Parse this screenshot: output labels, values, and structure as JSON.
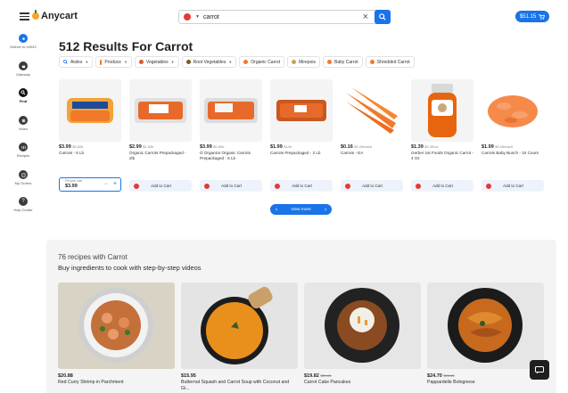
{
  "header": {
    "logo_text": "Anycart",
    "search_value": "carrot",
    "cart_total": "$51.15"
  },
  "sidebar": {
    "items": [
      {
        "label": "Deliver to 94043",
        "icon": "location-icon",
        "active": true
      },
      {
        "label": "Gateway",
        "icon": "store-icon"
      },
      {
        "label": "Find",
        "icon": "search-icon"
      },
      {
        "label": "Video",
        "icon": "video-icon"
      },
      {
        "label": "Recipes",
        "icon": "recipes-icon"
      },
      {
        "label": "My Orders",
        "icon": "orders-icon"
      },
      {
        "label": "Help Center",
        "icon": "help-icon"
      }
    ]
  },
  "results_title": "512 Results For Carrot",
  "chips": [
    {
      "label": "Aisles",
      "icon": "search-icon",
      "dropdown": true
    },
    {
      "label": "Produce",
      "icon": "carrot-icon",
      "dropdown": true
    },
    {
      "label": "Vegetables",
      "icon": "carrot-icon",
      "dropdown": true
    },
    {
      "label": "Root Vegetables",
      "icon": "carrot-icon",
      "dropdown": true
    },
    {
      "label": "Organic Carrot",
      "icon": "carrot-icon"
    },
    {
      "label": "Mirepois",
      "icon": "carrot-icon"
    },
    {
      "label": "Baby Carrot",
      "icon": "carrot-icon"
    },
    {
      "label": "Shredded Carrot",
      "icon": "carrot-icon"
    }
  ],
  "products": [
    {
      "price": "$3.99",
      "unit": "$0.8/lb",
      "name": "Carrots - 5 Lb"
    },
    {
      "price": "$2.99",
      "unit": "$1.5/lb",
      "name": "Organic Carrots Prepackaged - 2lb"
    },
    {
      "price": "$3.99",
      "unit": "$0.8/lb",
      "name": "O Organics Organic Carrots Prepackaged - 5 Lb"
    },
    {
      "price": "$1.99",
      "unit": "$1/lb",
      "name": "Carrots Prepackaged - 2 Lb"
    },
    {
      "price": "$0.16",
      "unit": "$0.16/each",
      "name": "Carrots - EA"
    },
    {
      "price": "$1.39",
      "unit": "$0.35/oz",
      "name": "Gerber 1st Foods Organic Carrot - 4 Oz"
    },
    {
      "price": "$1.99",
      "unit": "$0.08/each",
      "name": "Carrots Baby Bunch - 24 Count"
    }
  ],
  "quantity": {
    "label": "Fill your cart",
    "value": "$3.99",
    "minus": "−",
    "plus": "+"
  },
  "add_to_cart_label": "Add to Cart",
  "view_more_label": "View more",
  "recipes": {
    "title": "76 recipes with Carrot",
    "subtitle": "Buy ingredients to cook with step-by-step videos",
    "items": [
      {
        "price": "$20.88",
        "old_price": "",
        "name": "Red Curry Shrimp in Parchment"
      },
      {
        "price": "$15.95",
        "old_price": "",
        "name": "Butternut Squash and Carrot Soup with Coconut and Gi..."
      },
      {
        "price": "$19.82",
        "old_price": "$21.61",
        "name": "Carrot Cake Pancakes"
      },
      {
        "price": "$24.70",
        "old_price": "$25.61",
        "name": "Pappardelle Bolognese"
      }
    ]
  },
  "colors": {
    "accent": "#1a73e8",
    "carrot": "#f07a2a",
    "store_red": "#e53935"
  }
}
